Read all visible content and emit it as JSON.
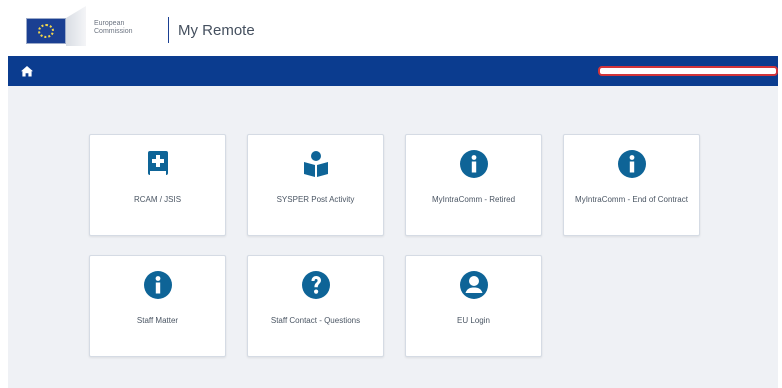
{
  "header": {
    "logo_text": "European\nCommission",
    "app_title": "My Remote"
  },
  "navbar": {
    "home_icon": "home-icon",
    "user_bar_icon": "user-menu"
  },
  "colors": {
    "navbar": "#0b3c8f",
    "icon": "#0e6497",
    "content_bg": "#eff1f5",
    "highlight": "#d2343a"
  },
  "tiles": [
    {
      "label": "RCAM / JSIS",
      "icon": "medical-book-icon"
    },
    {
      "label": "SYSPER Post Activity",
      "icon": "reader-icon"
    },
    {
      "label": "MyIntraComm - Retired",
      "icon": "info-icon"
    },
    {
      "label": "MyIntraComm - End of Contract",
      "icon": "info-icon"
    },
    {
      "label": "Staff Matter",
      "icon": "info-icon"
    },
    {
      "label": "Staff Contact - Questions",
      "icon": "question-icon"
    },
    {
      "label": "EU Login",
      "icon": "user-icon"
    }
  ]
}
